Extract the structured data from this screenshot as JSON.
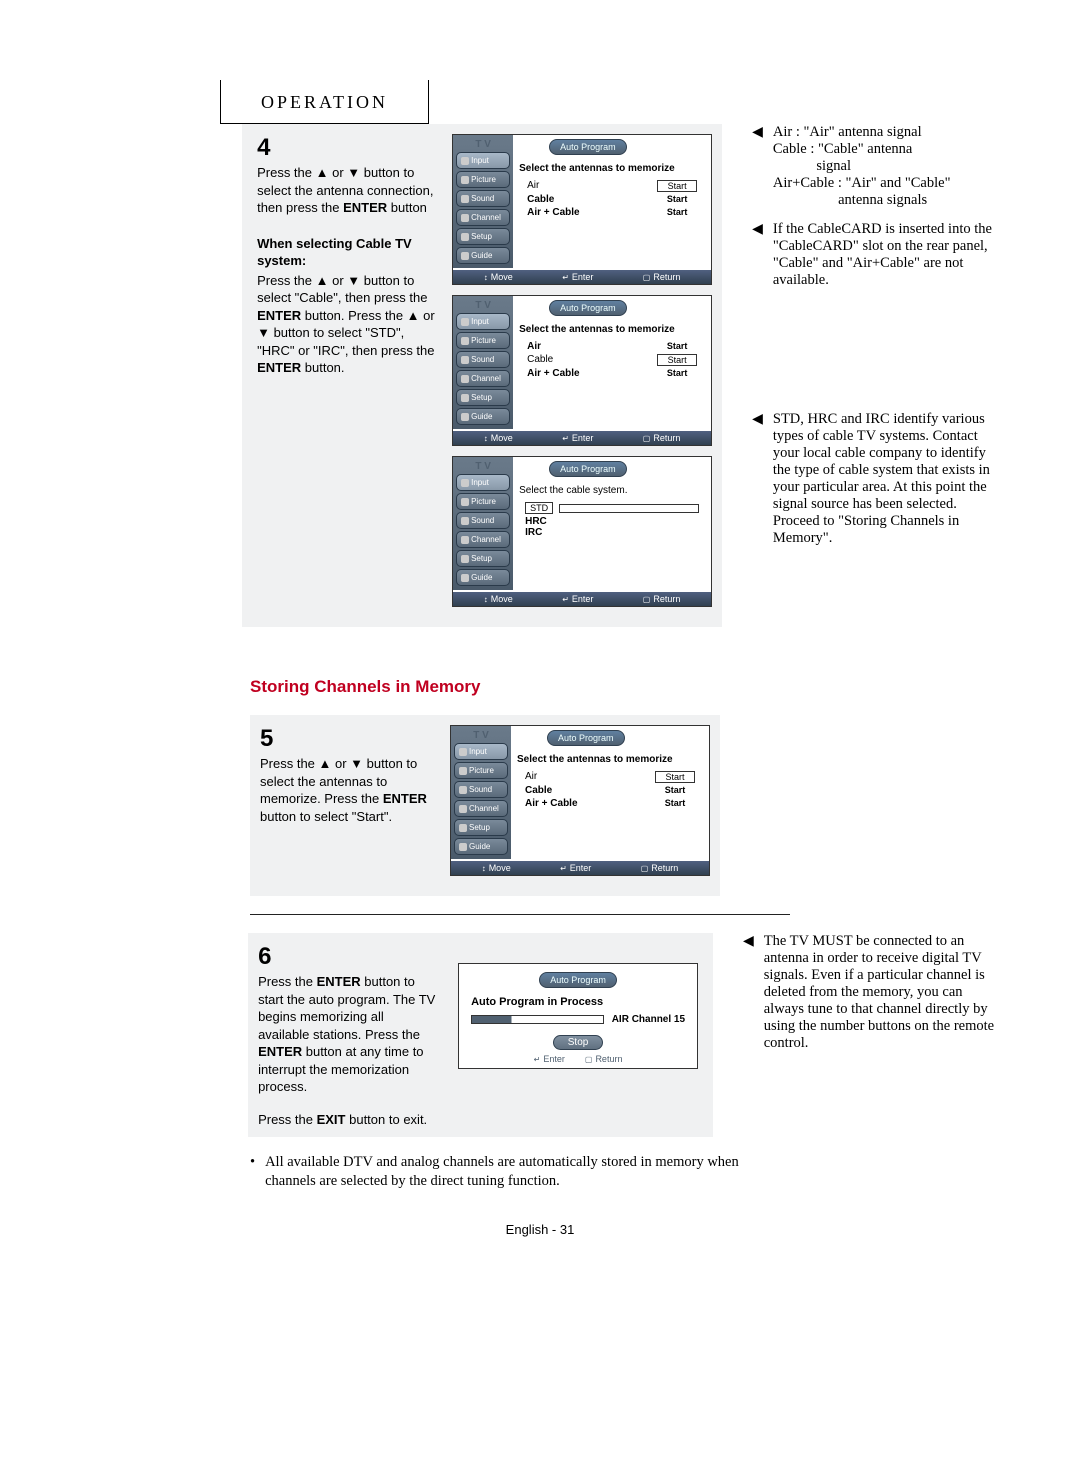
{
  "header": "OPERATION",
  "step4": {
    "num": "4",
    "text": "Press the ▲ or ▼ button to select the antenna connection, then press the ENTER button",
    "cableTitle": "When selecting Cable TV system:",
    "cableText": "Press the ▲ or ▼ button to select \"Cable\", then press the ENTER button. Press the ▲ or ▼ button to select \"STD\", \"HRC\" or \"IRC\", then press the ENTER button."
  },
  "menu": {
    "tv": "T V",
    "banner": "Auto Program",
    "tabs": [
      "Input",
      "Picture",
      "Sound",
      "Channel",
      "Setup",
      "Guide"
    ],
    "instruction1": "Select the antennas to memorize",
    "instruction2": "Select the cable system.",
    "rows": [
      {
        "label": "Air",
        "btn": "Start"
      },
      {
        "label": "Cable",
        "btn": "Start"
      },
      {
        "label": "Air + Cable",
        "btn": "Start"
      }
    ],
    "cable_rows": [
      "STD",
      "HRC",
      "IRC"
    ],
    "footer": {
      "move": "Move",
      "enter": "Enter",
      "return": "Return"
    }
  },
  "note4a": "Air : \"Air\" antenna signal\nCable : \"Cable\" antenna signal\nAir+Cable : \"Air\" and \"Cable\" antenna signals",
  "note4b": "If the CableCARD is inserted into the \"CableCARD\" slot on the rear panel, \"Cable\" and \"Air+Cable\" are not available.",
  "note4c": "STD, HRC and IRC identify various types of cable TV systems. Contact your local cable company to identify the type of cable system that exists in your particular area. At this point the signal source has been selected. Proceed to \"Storing Channels in Memory\".",
  "sectionTitle": "Storing Channels in Memory",
  "step5": {
    "num": "5",
    "text": "Press the ▲ or ▼ button to select the antennas to memorize. Press the ENTER button to select \"Start\"."
  },
  "step6": {
    "num": "6",
    "text": "Press the ENTER button to start the auto program. The TV begins memorizing all available stations. Press the ENTER button at any time to interrupt the memorization process.",
    "exit": "Press the EXIT button to exit."
  },
  "progress": {
    "title": "Auto Program in Process",
    "ch": "AIR Channel 15",
    "stop": "Stop",
    "enter": "Enter",
    "return": "Return"
  },
  "note6": "The TV MUST be connected to an antenna in order to receive digital TV signals. Even if a particular channel is deleted from the memory, you can always tune to that channel directly by using the number buttons on the remote control.",
  "bullet": "All available DTV and analog channels are automatically stored in memory when channels are selected by the direct tuning function.",
  "pageNum": "English - 31"
}
